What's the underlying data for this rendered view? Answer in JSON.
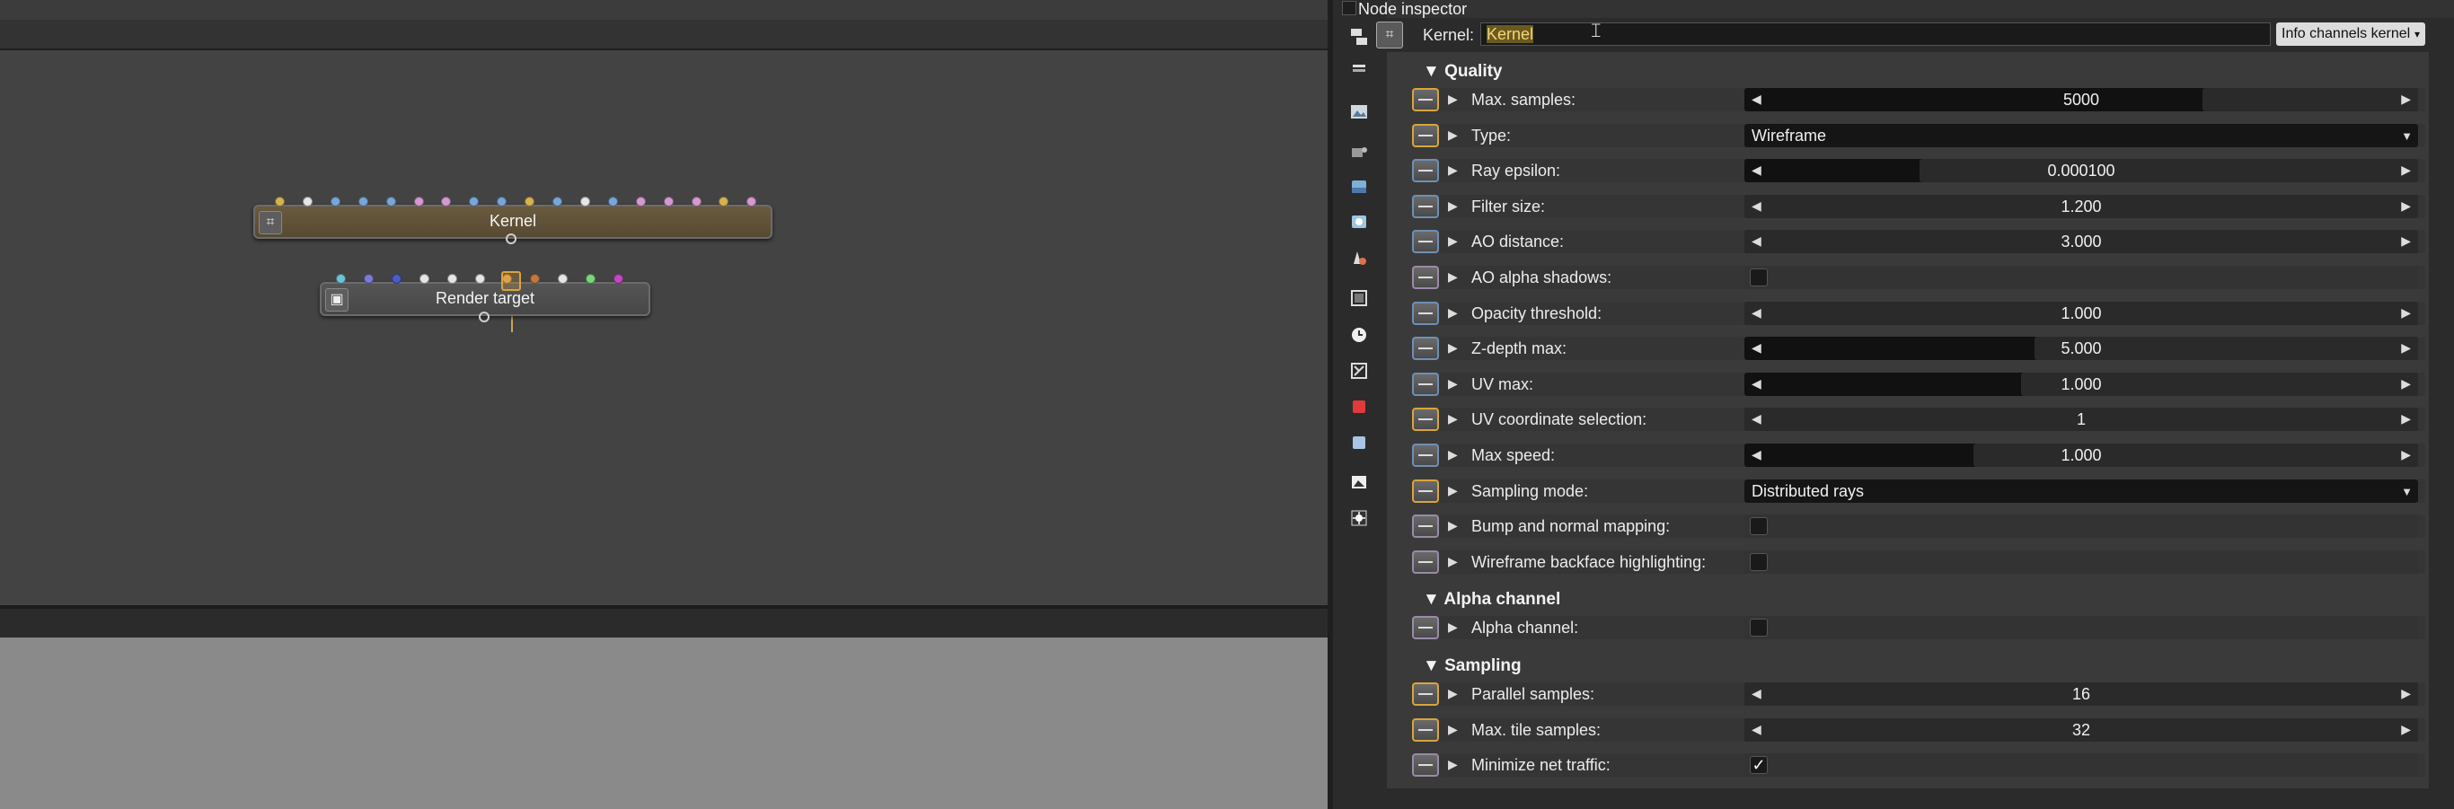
{
  "graph": {
    "nodes": [
      {
        "label": "Kernel",
        "pins": [
          "#d6b351",
          "#e6e6e6",
          "#7aa6d6",
          "#7aa6d6",
          "#7aa6d6",
          "#d49ad0",
          "#d49ad0",
          "#7aa6d6",
          "#7aa6d6",
          "#d6b351",
          "#7aa6d6",
          "#e6e6e6",
          "#7aa6d6",
          "#d49ad0",
          "#d49ad0",
          "#d49ad0",
          "#d6b351",
          "#d49ad0"
        ]
      },
      {
        "label": "Render target",
        "pins": [
          "#6fc1d6",
          "#7b7bd6",
          "#4b5cc9",
          "#e6e6e6",
          "#e6e6e6",
          "#e6e6e6",
          "#e6a24a",
          "#c07840",
          "#e6e6e6",
          "#7ad67a",
          "#c04ac0"
        ]
      }
    ]
  },
  "inspector": {
    "title": "Node inspector",
    "kernel_label": "Kernel:",
    "kernel_value": "Kernel",
    "kernel_dropdown": "Info channels kernel",
    "sections": [
      {
        "title": "▼ Quality",
        "rows": [
          {
            "label": "Max. samples:",
            "kind": "slider",
            "value": "5000",
            "fill": 0.68,
            "btn": "gold"
          },
          {
            "label": "Type:",
            "kind": "dropdown",
            "value": "Wireframe",
            "btn": "gold"
          },
          {
            "label": "Ray epsilon:",
            "kind": "slider",
            "value": "0.000100",
            "fill": 0.26,
            "btn": "blue"
          },
          {
            "label": "Filter size:",
            "kind": "slider",
            "value": "1.200",
            "fill": 0.0,
            "btn": "blue"
          },
          {
            "label": "AO distance:",
            "kind": "slider",
            "value": "3.000",
            "fill": 0.0,
            "btn": "blue"
          },
          {
            "label": "AO alpha shadows:",
            "kind": "bool",
            "value": "",
            "btn": "mauve"
          },
          {
            "label": "Opacity threshold:",
            "kind": "slider",
            "value": "1.000",
            "fill": 0.0,
            "btn": "blue"
          },
          {
            "label": "Z-depth max:",
            "kind": "slider",
            "value": "5.000",
            "fill": 0.43,
            "btn": "blue"
          },
          {
            "label": "UV max:",
            "kind": "slider",
            "value": "1.000",
            "fill": 0.41,
            "btn": "blue"
          },
          {
            "label": "UV coordinate selection:",
            "kind": "slider",
            "value": "1",
            "fill": 0.0,
            "btn": "gold"
          },
          {
            "label": "Max speed:",
            "kind": "slider",
            "value": "1.000",
            "fill": 0.34,
            "btn": "blue"
          },
          {
            "label": "Sampling mode:",
            "kind": "dropdown",
            "value": "Distributed rays",
            "btn": "gold"
          },
          {
            "label": "Bump and normal mapping:",
            "kind": "bool",
            "value": "",
            "btn": "mauve"
          },
          {
            "label": "Wireframe backface highlighting:",
            "kind": "bool",
            "value": "",
            "btn": "mauve"
          }
        ]
      },
      {
        "title": "▼ Alpha channel",
        "rows": [
          {
            "label": "Alpha channel:",
            "kind": "bool",
            "value": "",
            "btn": "mauve"
          }
        ]
      },
      {
        "title": "▼ Sampling",
        "rows": [
          {
            "label": "Parallel samples:",
            "kind": "slider",
            "value": "16",
            "fill": 0.0,
            "btn": "gold"
          },
          {
            "label": "Max. tile samples:",
            "kind": "slider",
            "value": "32",
            "fill": 0.0,
            "btn": "gold"
          },
          {
            "label": "Minimize net traffic:",
            "kind": "bool",
            "value": "✓",
            "btn": "mauve"
          }
        ]
      }
    ]
  },
  "toolbar_icons": [
    "node-graph-icon",
    "layers-icon",
    "render-target-icon",
    "camera-icon",
    "environment-icon",
    "geometry-icon",
    "material-icon",
    "texture-icon",
    "time-icon",
    "kernel-icon",
    "red-cube-icon",
    "blue-cube-icon",
    "image-icon",
    "light-icon"
  ]
}
